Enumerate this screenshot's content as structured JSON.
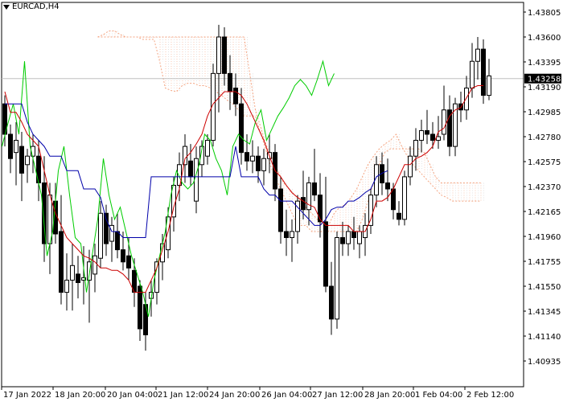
{
  "chart_title": "EURCAD,H4",
  "current_price_label": "1.43258",
  "colors": {
    "background": "#ffffff",
    "candle": "#000000",
    "tenkan": "#cc0000",
    "kijun": "#0000aa",
    "chikou": "#00cc00",
    "cloud_edge": "#f4a582",
    "current_price_line": "#c0c0c0",
    "current_price_box": "#000000",
    "current_price_text": "#ffffff"
  },
  "chart_data": {
    "type": "candlestick",
    "ylim": [
      1.40935,
      1.43805
    ],
    "y_ticks": [
      "1.43805",
      "1.43600",
      "1.43395",
      "1.43190",
      "1.42985",
      "1.42780",
      "1.42575",
      "1.42370",
      "1.42165",
      "1.41960",
      "1.41755",
      "1.41550",
      "1.41345",
      "1.41140",
      "1.40935"
    ],
    "x_tick_labels": [
      "17 Jan 2022",
      "18 Jan 20:00",
      "20 Jan 04:00",
      "21 Jan 12:00",
      "24 Jan 20:00",
      "26 Jan 04:00",
      "27 Jan 12:00",
      "28 Jan 20:00",
      "1 Feb 04:00",
      "2 Feb 12:00"
    ],
    "current_price": 1.43258,
    "candles": [
      [
        1.4305,
        1.4312,
        1.427,
        1.428
      ],
      [
        1.428,
        1.4288,
        1.4248,
        1.426
      ],
      [
        1.4265,
        1.429,
        1.4238,
        1.4275
      ],
      [
        1.427,
        1.4282,
        1.4225,
        1.4248
      ],
      [
        1.4255,
        1.4268,
        1.424,
        1.4262
      ],
      [
        1.4262,
        1.428,
        1.4248,
        1.427
      ],
      [
        1.4262,
        1.4275,
        1.4225,
        1.424
      ],
      [
        1.424,
        1.4262,
        1.4175,
        1.419
      ],
      [
        1.419,
        1.424,
        1.4165,
        1.423
      ],
      [
        1.4225,
        1.424,
        1.419,
        1.4198
      ],
      [
        1.42,
        1.423,
        1.414,
        1.415
      ],
      [
        1.415,
        1.4182,
        1.4135,
        1.416
      ],
      [
        1.416,
        1.419,
        1.4135,
        1.4172
      ],
      [
        1.4165,
        1.418,
        1.4145,
        1.4158
      ],
      [
        1.416,
        1.4188,
        1.414,
        1.4162
      ],
      [
        1.416,
        1.4185,
        1.4125,
        1.4175
      ],
      [
        1.4165,
        1.419,
        1.415,
        1.418
      ],
      [
        1.4178,
        1.4225,
        1.417,
        1.4215
      ],
      [
        1.4215,
        1.4222,
        1.418,
        1.419
      ],
      [
        1.4192,
        1.4212,
        1.4175,
        1.4205
      ],
      [
        1.42,
        1.4215,
        1.4178,
        1.4185
      ],
      [
        1.4185,
        1.42,
        1.4168,
        1.4175
      ],
      [
        1.418,
        1.4195,
        1.416,
        1.417
      ],
      [
        1.4168,
        1.4178,
        1.4138,
        1.415
      ],
      [
        1.4155,
        1.416,
        1.411,
        1.412
      ],
      [
        1.414,
        1.415,
        1.4102,
        1.4115
      ],
      [
        1.4145,
        1.416,
        1.413,
        1.415
      ],
      [
        1.415,
        1.4178,
        1.414,
        1.4175
      ],
      [
        1.4175,
        1.4198,
        1.416,
        1.419
      ],
      [
        1.4185,
        1.422,
        1.4178,
        1.4212
      ],
      [
        1.4212,
        1.4245,
        1.42,
        1.4238
      ],
      [
        1.4238,
        1.4265,
        1.4225,
        1.4255
      ],
      [
        1.4255,
        1.428,
        1.424,
        1.427
      ],
      [
        1.4258,
        1.4272,
        1.4238,
        1.4245
      ],
      [
        1.4225,
        1.427,
        1.4215,
        1.426
      ],
      [
        1.4255,
        1.4275,
        1.4245,
        1.427
      ],
      [
        1.4262,
        1.428,
        1.4255,
        1.4275
      ],
      [
        1.4275,
        1.4338,
        1.427,
        1.433
      ],
      [
        1.433,
        1.437,
        1.4298,
        1.436
      ],
      [
        1.436,
        1.4368,
        1.432,
        1.433
      ],
      [
        1.433,
        1.4345,
        1.43,
        1.4315
      ],
      [
        1.4318,
        1.433,
        1.4295,
        1.4305
      ],
      [
        1.4305,
        1.4318,
        1.4255,
        1.4265
      ],
      [
        1.4265,
        1.428,
        1.425,
        1.4258
      ],
      [
        1.4258,
        1.4275,
        1.4248,
        1.4262
      ],
      [
        1.4262,
        1.427,
        1.424,
        1.425
      ],
      [
        1.425,
        1.4268,
        1.4238,
        1.426
      ],
      [
        1.426,
        1.428,
        1.4248,
        1.4265
      ],
      [
        1.4265,
        1.4272,
        1.4225,
        1.4235
      ],
      [
        1.4235,
        1.4245,
        1.419,
        1.42
      ],
      [
        1.42,
        1.4218,
        1.418,
        1.4195
      ],
      [
        1.4195,
        1.421,
        1.4175,
        1.42
      ],
      [
        1.42,
        1.423,
        1.419,
        1.4225
      ],
      [
        1.4228,
        1.425,
        1.421,
        1.4218
      ],
      [
        1.4218,
        1.4245,
        1.4205,
        1.424
      ],
      [
        1.424,
        1.4268,
        1.4225,
        1.423
      ],
      [
        1.423,
        1.4248,
        1.4195,
        1.4208
      ],
      [
        1.4208,
        1.4245,
        1.415,
        1.4155
      ],
      [
        1.4155,
        1.4175,
        1.4115,
        1.4128
      ],
      [
        1.4128,
        1.42,
        1.412,
        1.4195
      ],
      [
        1.4195,
        1.4208,
        1.418,
        1.419
      ],
      [
        1.419,
        1.4205,
        1.418,
        1.42
      ],
      [
        1.42,
        1.4212,
        1.4185,
        1.4195
      ],
      [
        1.419,
        1.4205,
        1.4178,
        1.42
      ],
      [
        1.4195,
        1.4215,
        1.418,
        1.4205
      ],
      [
        1.4205,
        1.4235,
        1.4198,
        1.423
      ],
      [
        1.423,
        1.4262,
        1.422,
        1.4255
      ],
      [
        1.4255,
        1.4265,
        1.423,
        1.424
      ],
      [
        1.424,
        1.426,
        1.4225,
        1.4235
      ],
      [
        1.4235,
        1.424,
        1.421,
        1.4218
      ],
      [
        1.4215,
        1.4225,
        1.4205,
        1.421
      ],
      [
        1.421,
        1.425,
        1.4205,
        1.4245
      ],
      [
        1.4245,
        1.427,
        1.4238,
        1.4262
      ],
      [
        1.4262,
        1.4285,
        1.425,
        1.4275
      ],
      [
        1.4275,
        1.4292,
        1.4265,
        1.4283
      ],
      [
        1.4283,
        1.43,
        1.4272,
        1.428
      ],
      [
        1.428,
        1.429,
        1.4268,
        1.4275
      ],
      [
        1.4275,
        1.4295,
        1.4268,
        1.4278
      ],
      [
        1.428,
        1.432,
        1.4275,
        1.43
      ],
      [
        1.43,
        1.4312,
        1.4262,
        1.427
      ],
      [
        1.427,
        1.431,
        1.4262,
        1.4305
      ],
      [
        1.4305,
        1.4315,
        1.429,
        1.43
      ],
      [
        1.43,
        1.4328,
        1.4292,
        1.4318
      ],
      [
        1.4318,
        1.4355,
        1.431,
        1.434
      ],
      [
        1.434,
        1.436,
        1.4325,
        1.435
      ],
      [
        1.435,
        1.4358,
        1.4305,
        1.4312
      ],
      [
        1.4312,
        1.4342,
        1.4308,
        1.4328
      ]
    ],
    "tenkan": [
      1.4315,
      1.4298,
      1.4298,
      1.429,
      1.428,
      1.4275,
      1.427,
      1.425,
      1.423,
      1.4215,
      1.4205,
      1.4195,
      1.419,
      1.4185,
      1.418,
      1.4178,
      1.4175,
      1.417,
      1.417,
      1.4168,
      1.4168,
      1.4165,
      1.416,
      1.415,
      1.415,
      1.415,
      1.416,
      1.417,
      1.4185,
      1.42,
      1.422,
      1.4235,
      1.426,
      1.4265,
      1.4272,
      1.428,
      1.4295,
      1.4305,
      1.431,
      1.4315,
      1.4315,
      1.4315,
      1.4312,
      1.4305,
      1.4295,
      1.4285,
      1.4275,
      1.4262,
      1.425,
      1.4245,
      1.4238,
      1.4232,
      1.4228,
      1.4225,
      1.4222,
      1.422,
      1.421,
      1.4205,
      1.4205,
      1.4205,
      1.4205,
      1.4205,
      1.42,
      1.42,
      1.42,
      1.421,
      1.4225,
      1.4225,
      1.4228,
      1.4235,
      1.4245,
      1.4255,
      1.4255,
      1.426,
      1.4262,
      1.4265,
      1.427,
      1.4282,
      1.4285,
      1.4295,
      1.43,
      1.4302,
      1.431,
      1.4318,
      1.432,
      1.432
    ],
    "kijun": [
      1.4305,
      1.4305,
      1.4305,
      1.4305,
      1.429,
      1.428,
      1.4275,
      1.427,
      1.4262,
      1.4262,
      1.4262,
      1.425,
      1.425,
      1.425,
      1.4235,
      1.4235,
      1.4235,
      1.4228,
      1.421,
      1.42,
      1.42,
      1.4195,
      1.4195,
      1.4195,
      1.4195,
      1.4195,
      1.4245,
      1.4245,
      1.4245,
      1.4245,
      1.4245,
      1.4245,
      1.4245,
      1.4245,
      1.4245,
      1.4245,
      1.4245,
      1.4245,
      1.4245,
      1.4245,
      1.4245,
      1.427,
      1.4245,
      1.4245,
      1.4245,
      1.4245,
      1.4235,
      1.423,
      1.423,
      1.4225,
      1.4225,
      1.4225,
      1.422,
      1.4215,
      1.421,
      1.4205,
      1.4205,
      1.421,
      1.4218,
      1.422,
      1.422,
      1.4225,
      1.4225,
      1.4228,
      1.4232,
      1.4235,
      1.4245,
      1.4248,
      1.425
    ],
    "chikou": [
      1.427,
      1.4288,
      1.4305,
      1.428,
      1.434,
      1.427,
      1.425,
      1.423,
      1.418,
      1.42,
      1.425,
      1.427,
      1.423,
      1.4195,
      1.419,
      1.415,
      1.418,
      1.421,
      1.426,
      1.423,
      1.421,
      1.422,
      1.42,
      1.418,
      1.4165,
      1.415,
      1.413,
      1.416,
      1.418,
      1.42,
      1.423,
      1.425,
      1.424,
      1.4235,
      1.424,
      1.4255,
      1.428,
      1.4275,
      1.426,
      1.425,
      1.423,
      1.427,
      1.428,
      1.4275,
      1.4272,
      1.429,
      1.43,
      1.4275,
      1.4285,
      1.4295,
      1.4302,
      1.431,
      1.432,
      1.4325,
      1.432,
      1.4312,
      1.4325,
      1.434,
      1.432,
      1.433
    ],
    "senkou_a": [
      1.436,
      1.4362,
      1.4365,
      1.4365,
      1.4362,
      1.436,
      1.436,
      1.436,
      1.4358,
      1.4358,
      1.4358,
      1.434,
      1.4318,
      1.4316,
      1.4315,
      1.432,
      1.4322,
      1.4322,
      1.432,
      1.432,
      1.4318,
      1.4315,
      1.4312,
      1.4308,
      1.4305,
      1.43,
      1.4295,
      1.4295,
      1.4295,
      1.428,
      1.4265,
      1.425,
      1.424,
      1.423,
      1.422,
      1.421,
      1.4205,
      1.4205,
      1.42,
      1.42,
      1.42,
      1.4205,
      1.4215,
      1.422,
      1.4222,
      1.4228,
      1.4235,
      1.4245,
      1.4255,
      1.4262,
      1.4268,
      1.4272,
      1.4275,
      1.428,
      1.427,
      1.4262,
      1.4255,
      1.425,
      1.4245,
      1.424,
      1.4235,
      1.423,
      1.4228,
      1.4225,
      1.4225,
      1.4225,
      1.4225,
      1.4225,
      1.4225
    ],
    "senkou_b": [
      1.436,
      1.436,
      1.436,
      1.436,
      1.436,
      1.436,
      1.436,
      1.436,
      1.436,
      1.436,
      1.436,
      1.436,
      1.436,
      1.436,
      1.436,
      1.436,
      1.436,
      1.436,
      1.436,
      1.436,
      1.436,
      1.436,
      1.436,
      1.436,
      1.436,
      1.436,
      1.436,
      1.433,
      1.43,
      1.4285,
      1.427,
      1.426,
      1.425,
      1.424,
      1.4235,
      1.423,
      1.4225,
      1.422,
      1.4215,
      1.421,
      1.4205,
      1.42,
      1.42,
      1.42,
      1.42,
      1.42,
      1.42,
      1.421,
      1.4225,
      1.424,
      1.4255,
      1.4265,
      1.4268,
      1.4268,
      1.4268,
      1.4268,
      1.4268,
      1.4268,
      1.4265,
      1.4255,
      1.4245,
      1.424,
      1.424,
      1.424,
      1.424,
      1.424,
      1.424,
      1.424,
      1.424
    ]
  }
}
